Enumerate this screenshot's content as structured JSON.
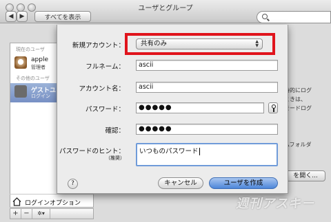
{
  "window": {
    "title": "ユーザとグループ",
    "show_all_label": "すべてを表示"
  },
  "sidebar": {
    "current_users_label": "現在のユーザ",
    "current_user": {
      "name": "apple",
      "role": "管理者"
    },
    "other_users_label": "その他のユーザ",
    "other_user": {
      "name": "ゲストユ",
      "sub": "ログイン"
    },
    "login_options_label": "ログインオプション",
    "add_symbol": "+",
    "remove_symbol": "−",
    "action_symbol": "✲▾"
  },
  "background": {
    "text_line1": "時的にログ",
    "text_line2": "ときは、",
    "text_line3": "モードログ",
    "text_line4": "ムフォルダ",
    "open_button": "を開く..."
  },
  "sheet": {
    "account_type_label": "新規アカウント：",
    "account_type_value": "共有のみ",
    "full_name_label": "フルネーム：",
    "full_name_value": "ascii",
    "account_name_label": "アカウント名：",
    "account_name_value": "ascii",
    "password_label": "パスワード：",
    "password_value": "●●●●●",
    "verify_label": "確認：",
    "verify_value": "●●●●●",
    "hint_label": "パスワードのヒント：",
    "hint_sublabel": "（推奨）",
    "hint_value": "いつものパスワード",
    "help_symbol": "?",
    "cancel_label": "キャンセル",
    "create_label": "ユーザを作成"
  },
  "watermark": "週刊アスキー",
  "colors": {
    "highlight_border": "#e0141c",
    "default_button": "#4d86d9",
    "selection": "#7790c4"
  }
}
